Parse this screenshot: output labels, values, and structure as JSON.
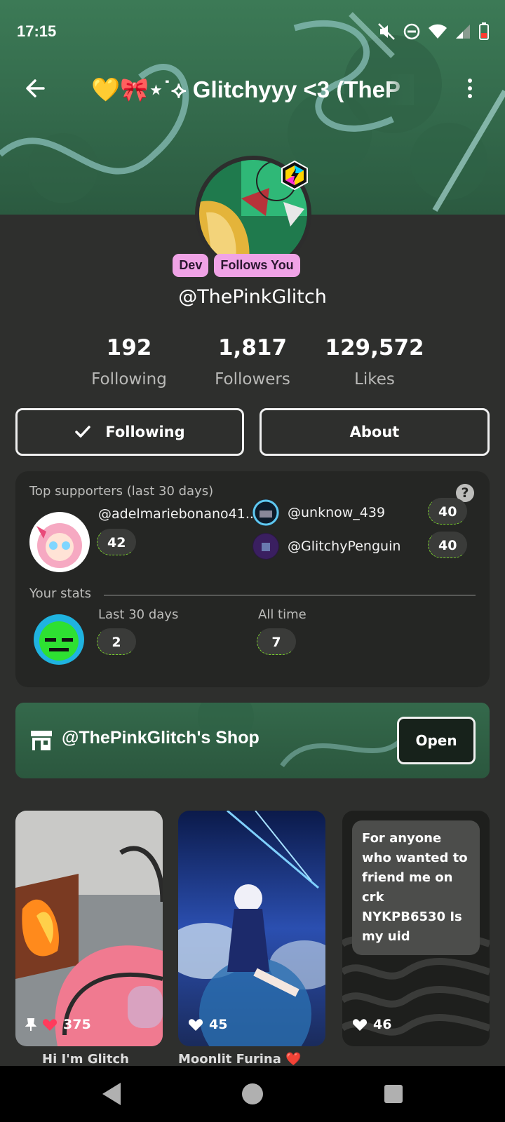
{
  "status_bar": {
    "time": "17:15"
  },
  "header": {
    "title": "💛🎀⋆˙⟡ Glitchyyy <3 (TheP"
  },
  "profile": {
    "tags": [
      "Dev",
      "Follows You"
    ],
    "username": "@ThePinkGlitch",
    "stats": [
      {
        "value": "192",
        "label": "Following"
      },
      {
        "value": "1,817",
        "label": "Followers"
      },
      {
        "value": "129,572",
        "label": "Likes"
      }
    ],
    "following_label": "Following",
    "about_label": "About"
  },
  "supporters": {
    "heading": "Top supporters (last 30 days)",
    "help": "?",
    "top": {
      "name": "@adelmariebonano41...",
      "count": "42"
    },
    "others": [
      {
        "name": "@unknow_439",
        "count": "40"
      },
      {
        "name": "@GlitchyPenguin",
        "count": "40"
      }
    ],
    "your_stats_label": "Your stats",
    "last30_label": "Last 30 days",
    "last30_value": "2",
    "alltime_label": "All time",
    "alltime_value": "7"
  },
  "shop": {
    "title": "@ThePinkGlitch's Shop",
    "open_label": "Open"
  },
  "posts": [
    {
      "likes": "375",
      "pinned": true,
      "caption": "Hi I'm Glitch"
    },
    {
      "likes": "45",
      "pinned": false,
      "caption": "Moonlit Furina ❤️"
    },
    {
      "likes": "46",
      "pinned": false,
      "text": "For anyone who wanted to friend me on crk NYKPB6530 Is my uid"
    }
  ],
  "colors": {
    "accent_pink": "#f0a3e6",
    "like_red": "#ff3b5c",
    "banner_green": "#3c7a56",
    "pill_highlight": "#7ad42b"
  }
}
